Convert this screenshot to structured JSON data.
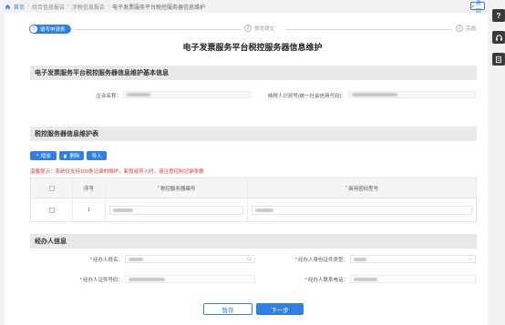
{
  "breadcrumb": {
    "home": "首页",
    "items": [
      "综合信息报告",
      "涉税信息报告"
    ],
    "current": "电子发票服务平台税控服务器信息维护"
  },
  "back_label": "返回",
  "steps": [
    {
      "num": "1",
      "label": "填写申请表"
    },
    {
      "num": "2",
      "label": "预览提交"
    },
    {
      "num": "3",
      "label": "完成"
    }
  ],
  "page_title": "电子发票服务平台税控服务器信息维护",
  "basic_info": {
    "title": "电子发票服务平台税控服务器信息维护基本信息",
    "company_label": "企业名称：",
    "taxid_label": "纳税人识别号(统一社会信用代码)："
  },
  "server_table": {
    "title": "税控服务器信息维护表",
    "add_label": "增加",
    "delete_label": "删除",
    "import_label": "导入",
    "notice": "温馨提示：系统仅支持100条记录的维护，新增或导入时，请注意控制记录条数",
    "columns": [
      "序号",
      "税控服务器编号",
      "商用密码型号"
    ],
    "rows": [
      {
        "index": "1"
      }
    ]
  },
  "agent_info": {
    "title": "经办人信息",
    "name_label": "经办人姓名：",
    "idtype_label": "经办人身份证件类型：",
    "idnum_label": "经办人证件号码：",
    "phone_label": "经办人联系电话："
  },
  "footer": {
    "save_label": "暂存",
    "next_label": "下一步"
  },
  "colors": {
    "accent": "#2f7fe6",
    "warning": "#e33333",
    "section_bg": "#e9e9e9"
  },
  "icons": {
    "rail": [
      "question-icon",
      "headset-icon",
      "document-icon"
    ]
  }
}
